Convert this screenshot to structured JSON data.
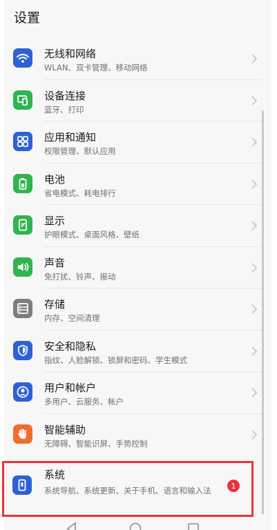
{
  "header": {
    "title": "设置"
  },
  "settings": [
    {
      "title": "无线和网络",
      "subtitle": "WLAN、双卡管理、移动网络",
      "icon": "wifi-icon",
      "color": "#2f61d6"
    },
    {
      "title": "设备连接",
      "subtitle": "蓝牙、打印",
      "icon": "device-connection-icon",
      "color": "#2fb44f"
    },
    {
      "title": "应用和通知",
      "subtitle": "权限管理、默认应用",
      "icon": "apps-icon",
      "color": "#2f61d6"
    },
    {
      "title": "电池",
      "subtitle": "省电模式、耗电排行",
      "icon": "battery-icon",
      "color": "#2fb44f"
    },
    {
      "title": "显示",
      "subtitle": "护眼模式、桌面风格、壁纸",
      "icon": "display-icon",
      "color": "#2fb44f"
    },
    {
      "title": "声音",
      "subtitle": "免打扰、铃声、振动",
      "icon": "sound-icon",
      "color": "#2fb44f"
    },
    {
      "title": "存储",
      "subtitle": "内存、空间清理",
      "icon": "storage-icon",
      "color": "#7d7d7d"
    },
    {
      "title": "安全和隐私",
      "subtitle": "指纹、人脸解锁、锁屏和密码、学生模式",
      "icon": "shield-icon",
      "color": "#2f61d6"
    },
    {
      "title": "用户和帐户",
      "subtitle": "多用户、云服务、帐户",
      "icon": "user-icon",
      "color": "#2f61d6"
    },
    {
      "title": "智能辅助",
      "subtitle": "无障碍、智能识屏、手势控制",
      "icon": "hand-icon",
      "color": "#f26c2e"
    }
  ],
  "system": {
    "title": "系统",
    "subtitle": "系统导航、系统更新、关于手机、语言和输入法",
    "icon": "phone-icon",
    "color": "#2f61d6",
    "badge": "1",
    "highlight_color": "#ee3338"
  },
  "navigation": {
    "back_icon": "back-icon",
    "home_icon": "home-icon",
    "recents_icon": "recents-icon"
  }
}
